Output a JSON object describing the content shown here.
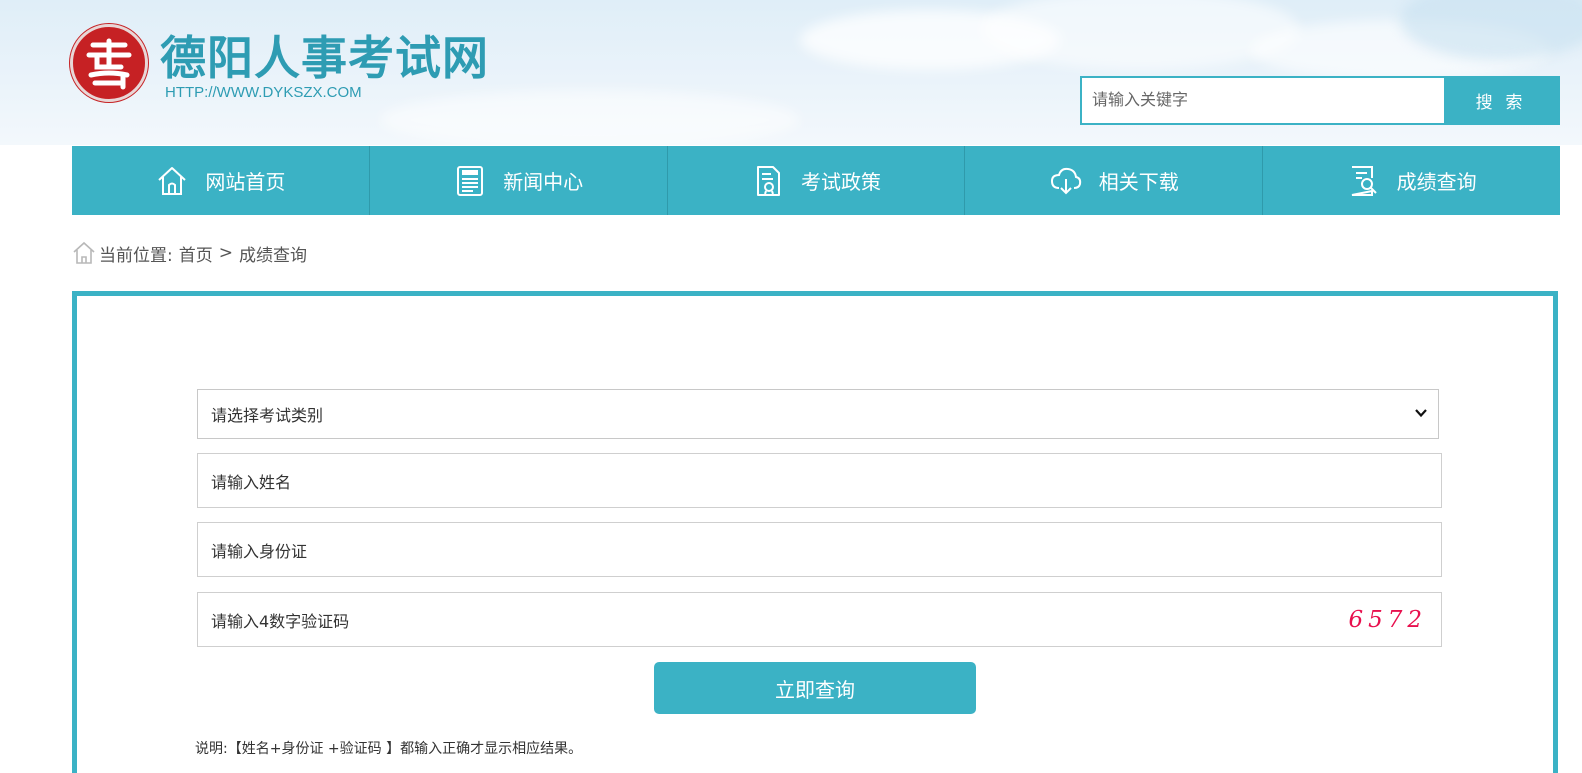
{
  "header": {
    "site_title": "德阳人事考试网",
    "site_url": "HTTP://WWW.DYKSZX.COM",
    "logo_glyph": "seal-icon"
  },
  "search": {
    "placeholder": "请输入关键字",
    "button_label": "搜 索"
  },
  "nav": {
    "items": [
      {
        "label": "网站首页",
        "icon": "home-icon"
      },
      {
        "label": "新闻中心",
        "icon": "news-icon"
      },
      {
        "label": "考试政策",
        "icon": "document-icon"
      },
      {
        "label": "相关下载",
        "icon": "cloud-download-icon"
      },
      {
        "label": "成绩查询",
        "icon": "search-document-icon"
      }
    ]
  },
  "breadcrumb": {
    "prefix": "当前位置:",
    "home": "首页",
    "separator": ">",
    "current": "成绩查询"
  },
  "form": {
    "exam_type_selected": "请选择考试类别",
    "name_placeholder": "请输入姓名",
    "id_placeholder": "请输入身份证",
    "captcha_placeholder": "请输入4数字验证码",
    "captcha_value": "6572",
    "submit_label": "立即查询",
    "note": "说明:【姓名+身份证 +验证码 】都输入正确才显示相应结果。"
  },
  "colors": {
    "accent": "#3bb2c5",
    "seal_red": "#c62124",
    "captcha": "#e8104e"
  }
}
